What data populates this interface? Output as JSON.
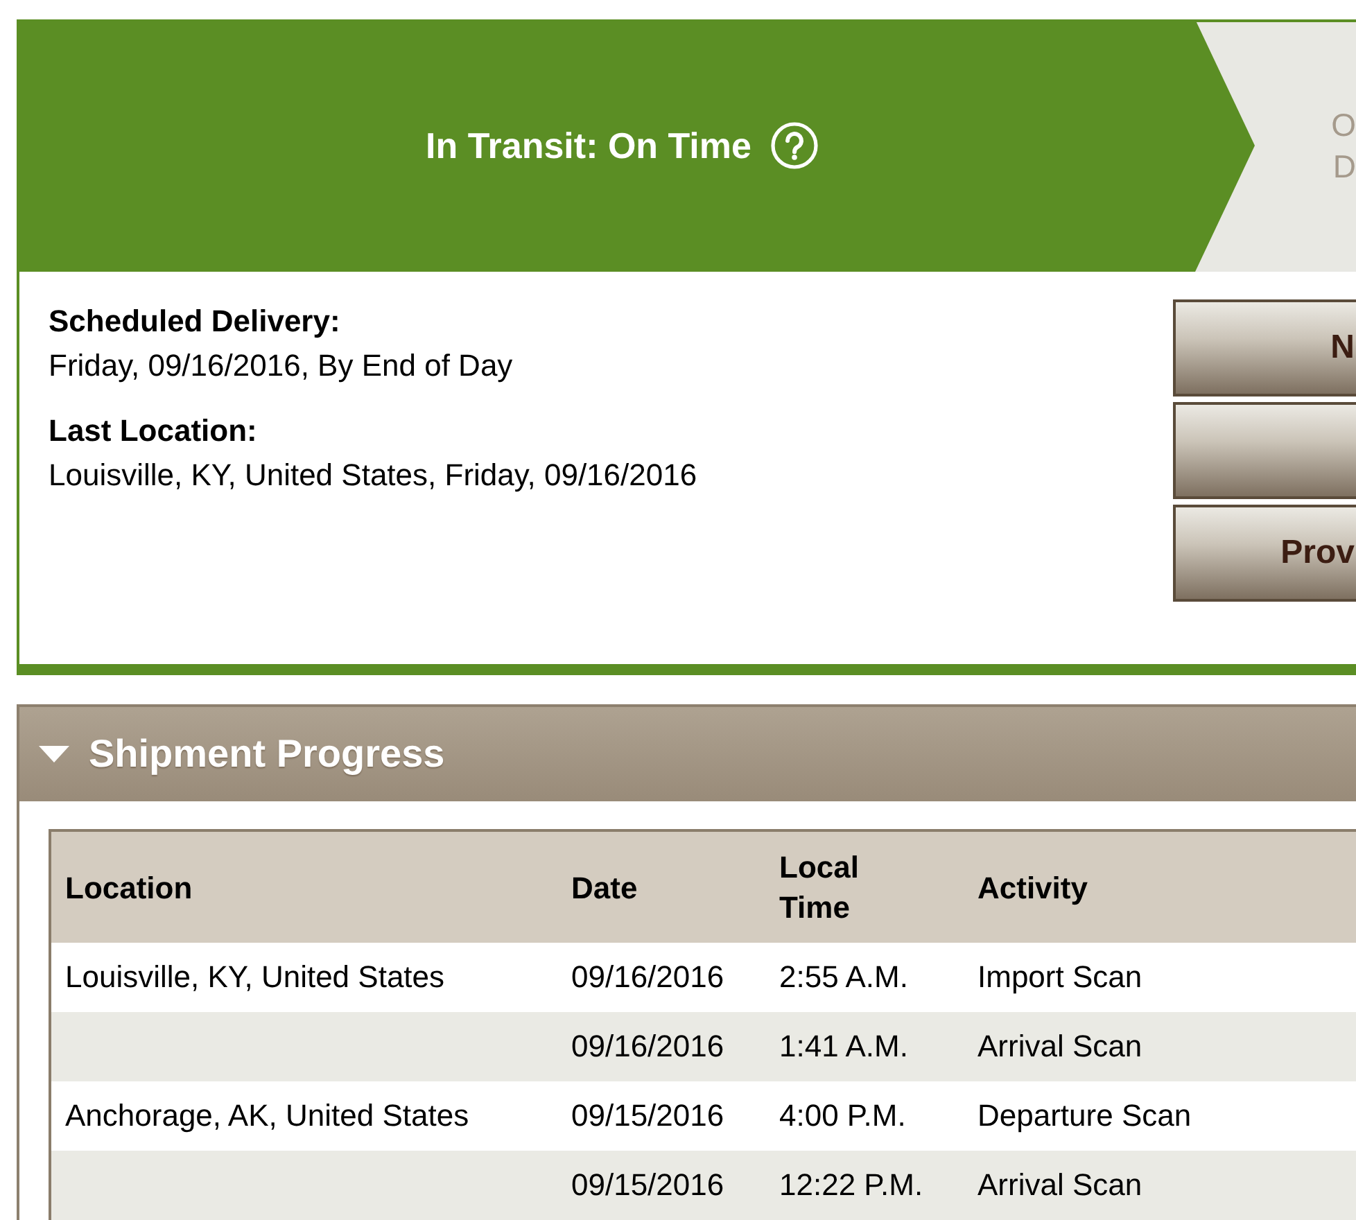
{
  "status_banner": {
    "title": "In Transit: On Time",
    "next_step_lines": [
      "O",
      "D"
    ]
  },
  "details": [
    {
      "label": "Scheduled Delivery:",
      "value": "Friday, 09/16/2016, By End of Day"
    },
    {
      "label": "Last Location:",
      "value": "Louisville, KY, United States, Friday, 09/16/2016"
    }
  ],
  "buttons": [
    {
      "kind": "labeled",
      "label": "N"
    },
    {
      "kind": "blank"
    },
    {
      "kind": "labeled",
      "label": "Prov"
    }
  ],
  "shipment_progress": {
    "title": "Shipment Progress",
    "expanded": true,
    "columns": [
      "Location",
      "Date",
      "Local Time",
      "Activity"
    ],
    "rows": [
      {
        "location": "Louisville, KY, United States",
        "date": "09/16/2016",
        "local_time": "2:55 A.M.",
        "activity": "Import Scan"
      },
      {
        "date": "09/16/2016",
        "local_time": "1:41 A.M.",
        "activity": "Arrival Scan"
      },
      {
        "location": "Anchorage, AK, United States",
        "date": "09/15/2016",
        "local_time": "4:00 P.M.",
        "activity": "Departure Scan"
      },
      {
        "date": "09/15/2016",
        "local_time": "12:22 P.M.",
        "activity": "Arrival Scan"
      }
    ]
  }
}
